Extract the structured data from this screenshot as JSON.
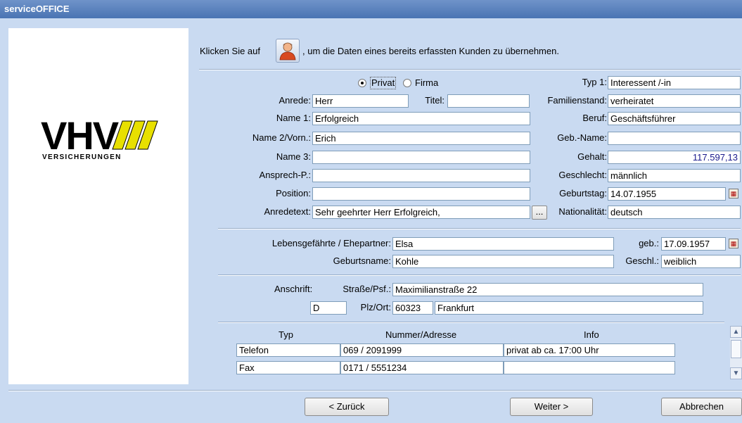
{
  "window": {
    "title": "serviceOFFICE"
  },
  "logo": {
    "main": "VHV",
    "sub": "VERSICHERUNGEN"
  },
  "intro": {
    "prefix": "Klicken Sie auf",
    "suffix": ", um die Daten eines bereits erfassten Kunden zu übernehmen."
  },
  "radios": {
    "privat": "Privat",
    "firma": "Firma",
    "selected": "Privat"
  },
  "person": {
    "anrede_label": "Anrede:",
    "anrede": "Herr",
    "titel_label": "Titel:",
    "titel": "",
    "name1_label": "Name 1:",
    "name1": "Erfolgreich",
    "name2_label": "Name 2/Vorn.:",
    "name2": "Erich",
    "name3_label": "Name 3:",
    "name3": "",
    "ansprech_label": "Ansprech-P.:",
    "ansprech": "",
    "position_label": "Position:",
    "position": "",
    "anredetext_label": "Anredetext:",
    "anredetext": "Sehr geehrter Herr Erfolgreich,",
    "dots_button": "..."
  },
  "details": {
    "typ1_label": "Typ 1:",
    "typ1": "Interessent /-in",
    "familienstand_label": "Familienstand:",
    "familienstand": "verheiratet",
    "beruf_label": "Beruf:",
    "beruf": "Geschäftsführer",
    "gebname_label": "Geb.-Name:",
    "gebname": "",
    "gehalt_label": "Gehalt:",
    "gehalt": "117.597,13",
    "geschlecht_label": "Geschlecht:",
    "geschlecht": "männlich",
    "geburtstag_label": "Geburtstag:",
    "geburtstag": "14.07.1955",
    "nationalitaet_label": "Nationalität:",
    "nationalitaet": "deutsch"
  },
  "partner": {
    "label": "Lebensgefährte / Ehepartner:",
    "name": "Elsa",
    "geb_label": "geb.:",
    "geb": "17.09.1957",
    "geburtsname_label": "Geburtsname:",
    "geburtsname": "Kohle",
    "geschl_label": "Geschl.:",
    "geschl": "weiblich"
  },
  "address": {
    "label": "Anschrift:",
    "strasse_label": "Straße/Psf.:",
    "strasse": "Maximilianstraße 22",
    "land": "D",
    "plzort_label": "Plz/Ort:",
    "plz": "60323",
    "ort": "Frankfurt"
  },
  "contacts": {
    "headers": [
      "Typ",
      "Nummer/Adresse",
      "Info"
    ],
    "rows": [
      [
        "Telefon",
        "069 / 2091999",
        "privat ab ca. 17:00 Uhr"
      ],
      [
        "Fax",
        "0171 / 5551234",
        ""
      ]
    ]
  },
  "buttons": {
    "back": "< Zurück",
    "next": "Weiter >",
    "cancel": "Abbrechen"
  },
  "colors": {
    "background": "#c9daf1",
    "titlebar": "#4a74b3",
    "gehalt_text": "#1a1a8c"
  }
}
